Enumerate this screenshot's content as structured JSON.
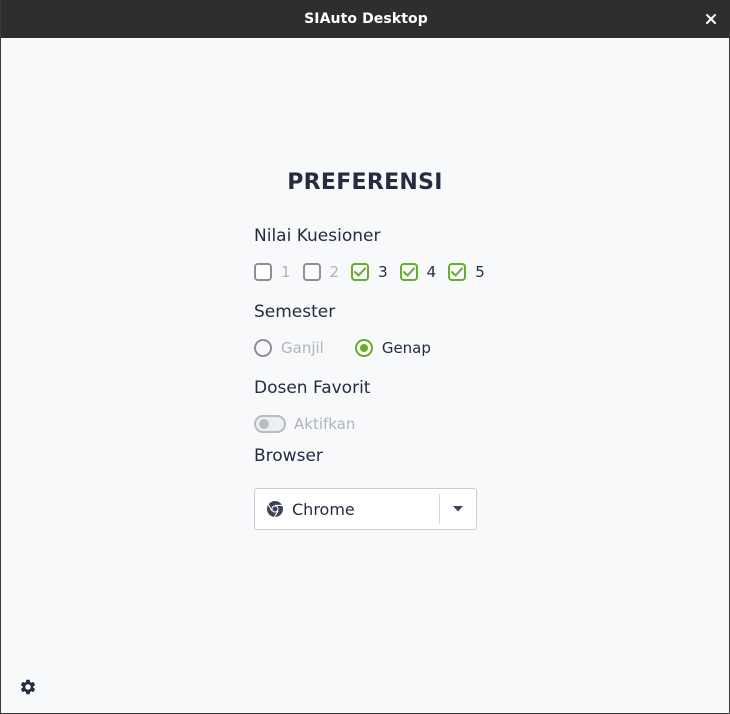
{
  "window": {
    "title": "SIAuto Desktop",
    "close_glyph": "✕"
  },
  "page": {
    "heading": "PREFERENSI"
  },
  "nilai": {
    "label": "Nilai Kuesioner",
    "options": [
      {
        "label": "1",
        "checked": false
      },
      {
        "label": "2",
        "checked": false
      },
      {
        "label": "3",
        "checked": true
      },
      {
        "label": "4",
        "checked": true
      },
      {
        "label": "5",
        "checked": true
      }
    ]
  },
  "semester": {
    "label": "Semester",
    "options": [
      {
        "label": "Ganjil",
        "selected": false
      },
      {
        "label": "Genap",
        "selected": true
      }
    ]
  },
  "dosen": {
    "label": "Dosen Favorit",
    "toggle_label": "Aktifkan",
    "enabled": false
  },
  "browser": {
    "label": "Browser",
    "selected": "Chrome",
    "icon": "chrome-icon"
  },
  "colors": {
    "accent": "#6aab2e",
    "title_bar": "#2e2e2e",
    "text": "#262c40",
    "muted": "#b0b3b8",
    "background": "#f7f9fb"
  },
  "icons": {
    "settings": "gear-icon",
    "dropdown": "caret-down-icon",
    "close": "close-icon"
  }
}
